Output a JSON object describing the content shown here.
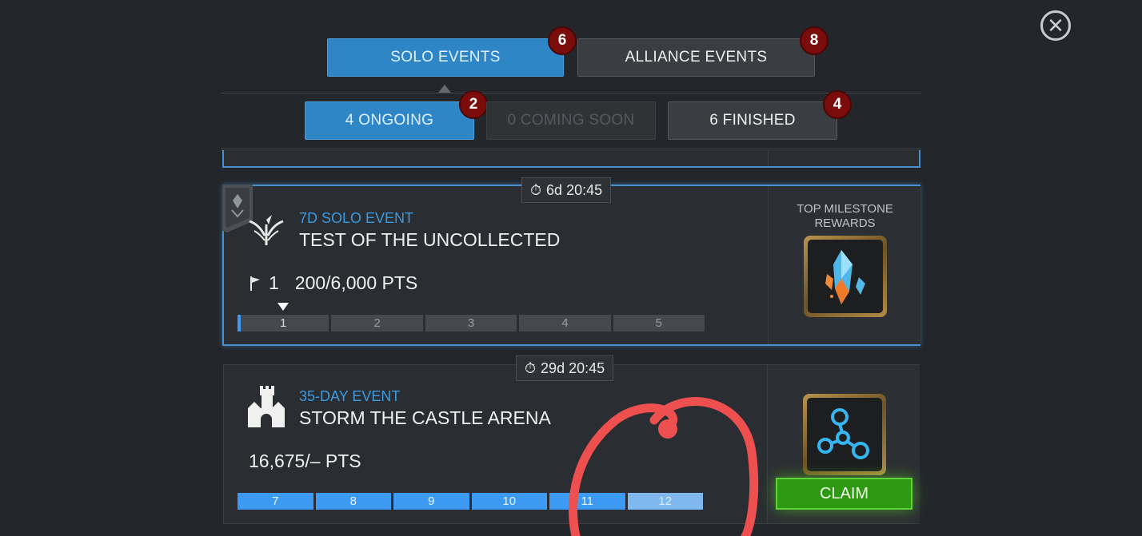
{
  "main_tabs": [
    {
      "label": "SOLO EVENTS",
      "badge": "6"
    },
    {
      "label": "ALLIANCE EVENTS",
      "badge": "8"
    }
  ],
  "sub_tabs": [
    {
      "label": "4 ONGOING",
      "badge": "2"
    },
    {
      "label": "0 COMING SOON"
    },
    {
      "label": "6 FINISHED",
      "badge": "4"
    }
  ],
  "events": [
    {
      "timer": "6d 20:45",
      "type": "7D SOLO EVENT",
      "title": "TEST OF THE UNCOLLECTED",
      "rank": "1",
      "points": "200/6,000 PTS",
      "milestones": [
        "1",
        "2",
        "3",
        "4",
        "5"
      ],
      "current_milestone": 1,
      "reward_label": "TOP MILESTONE REWARDS",
      "reward_icon": "crystal-icon"
    },
    {
      "timer": "29d 20:45",
      "type": "35-DAY EVENT",
      "title": "STORM THE CASTLE ARENA",
      "points": "16,675/– PTS",
      "milestones": [
        "7",
        "8",
        "9",
        "10",
        "11",
        "12"
      ],
      "reward_icon": "catalyst-icon",
      "claim_label": "CLAIM"
    }
  ],
  "colors": {
    "accent_blue": "#2f86c6",
    "badge_red": "#7a0c0c",
    "claim_green": "#2e9a12",
    "annotation_red": "#ee4f4f"
  }
}
